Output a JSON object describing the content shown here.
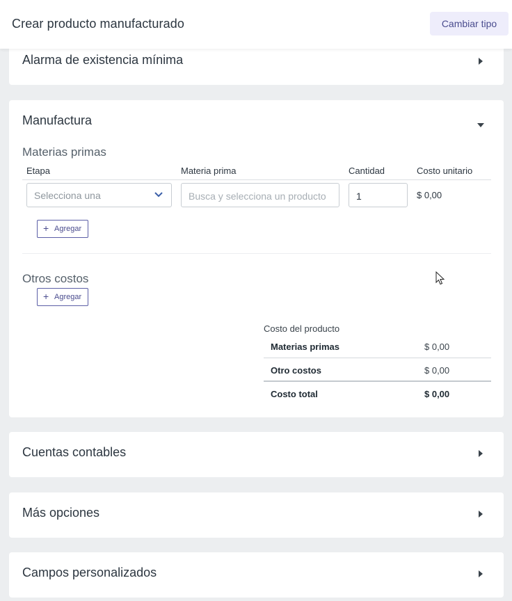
{
  "header": {
    "title": "Crear producto manufacturado",
    "change_type_label": "Cambiar tipo"
  },
  "sections": {
    "min_stock": {
      "title": "Alarma de existencia mínima"
    },
    "manufacturing": {
      "title": "Manufactura"
    },
    "accounts": {
      "title": "Cuentas contables"
    },
    "more_options": {
      "title": "Más opciones"
    },
    "custom_fields": {
      "title": "Campos personalizados"
    }
  },
  "raw_materials": {
    "heading": "Materias primas",
    "columns": [
      "Etapa",
      "Materia prima",
      "Cantidad",
      "Costo unitario"
    ],
    "row": {
      "stage_placeholder": "Selecciona una",
      "material_placeholder": "Busca y selecciona un producto",
      "quantity": "1",
      "unit_cost": "$ 0,00"
    },
    "add_label": "Agregar"
  },
  "other_costs": {
    "heading": "Otros costos",
    "add_label": "Agregar"
  },
  "summary": {
    "caption": "Costo del producto",
    "rows": [
      {
        "label": "Materias primas",
        "value": "$ 0,00"
      },
      {
        "label": "Otro costos",
        "value": "$ 0,00"
      },
      {
        "label": "Costo total",
        "value": "$ 0,00"
      }
    ]
  },
  "colors": {
    "accent": "#4a4c8e",
    "accent_bg": "#eeedfb",
    "page_bg": "#eceef0"
  }
}
